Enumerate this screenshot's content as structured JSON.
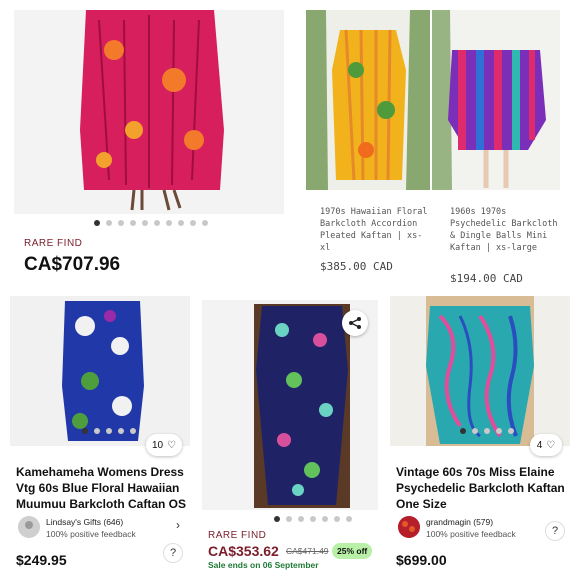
{
  "listings": [
    {
      "rare_label": "RARE FIND",
      "price": "CA$707.96",
      "carousel_total": 10,
      "carousel_active": 0
    },
    {
      "title": "1970s Hawaiian Floral Barkcloth Accordion Pleated Kaftan | xs-xl",
      "price": "$385.00 CAD"
    },
    {
      "title": "1960s 1970s Psychedelic Barkcloth & Dingle Balls Mini Kaftan | xs-large",
      "price": "$194.00 CAD"
    },
    {
      "likes": "10",
      "title": "Kamehameha Womens Dress Vtg 60s Blue Floral Hawaiian Muumuu Barkcloth Caftan OS",
      "seller": "Lindsay's Gifts (646)",
      "feedback": "100% positive feedback",
      "price": "$249.95",
      "help": "?",
      "carousel_total": 5,
      "carousel_active": 0
    },
    {
      "rare_label": "RARE FIND",
      "price": "CA$353.62",
      "original_price": "CA$471.49",
      "discount": "25% off",
      "sale_text": "Sale ends on 06 September",
      "carousel_total": 7,
      "carousel_active": 0
    },
    {
      "likes": "4",
      "title": "Vintage 60s 70s Miss Elaine Psychedelic Barkcloth Kaftan One Size",
      "seller": "grandmagin (579)",
      "feedback": "100% positive feedback",
      "price": "$699.00",
      "help": "?",
      "carousel_total": 5,
      "carousel_active": 0
    }
  ],
  "colors": {
    "rare": "#7a1e2b",
    "sale_green": "#1f7a36",
    "discount_bg": "#b7f0a6"
  },
  "icons": {
    "like": "heart-icon",
    "share": "share-icon",
    "next": "chevron-right-icon"
  }
}
